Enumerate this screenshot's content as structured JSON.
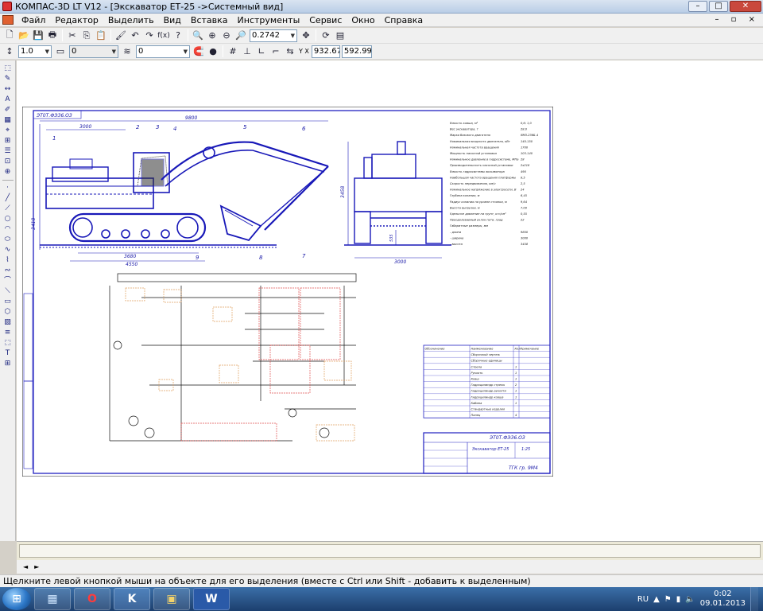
{
  "window": {
    "title": "КОМПАС-3D LT V12 - [Экскаватор ЕТ-25 ->Системный вид]",
    "minimize": "–",
    "maximize": "□",
    "close": "✕"
  },
  "menu": [
    "Файл",
    "Редактор",
    "Выделить",
    "Вид",
    "Вставка",
    "Инструменты",
    "Сервис",
    "Окно",
    "Справка"
  ],
  "mdi_controls": "– ▫ ×",
  "toolbar1": {
    "zoom_value": "0.2742",
    "icons": [
      "new-icon",
      "open-icon",
      "save-icon",
      "print-preview-icon",
      "cut-icon",
      "copy-icon",
      "paste-icon",
      "format-brush-icon",
      "undo-icon",
      "redo-icon",
      "function-icon",
      "help-pointer-icon",
      "zoom-window-icon",
      "zoom-in-icon",
      "zoom-out-icon",
      "zoom-scale-icon",
      "pan-icon",
      "refresh-icon",
      "layers-icon"
    ]
  },
  "toolbar2": {
    "scale_value": "1.0",
    "style_value": "0",
    "layer_value": "0",
    "coord_x": "932.679",
    "coord_y": "592.996",
    "coord_label": "Y X"
  },
  "status": {
    "text": "Щелкните левой кнопкой мыши на объекте для его выделения (вместе с Ctrl или Shift - добавить к выделенным)"
  },
  "taskbar": {
    "start_label": "⊞",
    "buttons": [
      {
        "name": "explorer",
        "label": "▦"
      },
      {
        "name": "opera",
        "label": "O"
      },
      {
        "name": "kompas",
        "label": "K"
      },
      {
        "name": "folder",
        "label": "▣"
      },
      {
        "name": "word",
        "label": "W"
      }
    ],
    "lang": "RU",
    "time": "0:02",
    "date": "09.01.2013"
  },
  "drawing": {
    "stamp_code": "ЭТ0Т.ФЭЗ6.ОЗ",
    "overall_length": "9800",
    "boom_length": "3000",
    "track_len_1": "3680",
    "track_len_2": "4550",
    "height_left": "3418",
    "side_width": "3000",
    "side_height": "3458",
    "clearance": "535",
    "callouts": [
      "1",
      "2",
      "3",
      "4",
      "5",
      "6",
      "7",
      "8",
      "9"
    ],
    "title_block_name": "Экскаватор ЕТ-25",
    "title_block_code": "ЭТ0Т.ФЭЗ6.ОЗ",
    "title_sheet": "ТГК гр. 9М4",
    "title_scale": "1:25",
    "spec_header": [
      "Обозначение",
      "Наименование",
      "Кол",
      "Примечание"
    ],
    "tech_rows": [
      {
        "label": "Емкость ковша, м³",
        "value": "0,6; 1,0"
      },
      {
        "label": "Вес экскаватора, т",
        "value": "28,0"
      },
      {
        "label": "Марка базового двигателя",
        "value": "ЯМЗ-236Б-4"
      },
      {
        "label": "Номинальная мощность двигателя, кВт",
        "value": "140-150"
      },
      {
        "label": "Номинальная частота вращения",
        "value": "1700"
      },
      {
        "label": "Мощность насосной установки",
        "value": "103-140"
      },
      {
        "label": "Номинальное давление в гидросистеме, МПа",
        "value": "28"
      },
      {
        "label": "Производительность насосной установки",
        "value": "2х218"
      },
      {
        "label": "Емкость гидросистемы экскаватора",
        "value": "490"
      },
      {
        "label": "Наибольшая частота вращения платформы",
        "value": "8,5"
      },
      {
        "label": "Скорость передвижения, км/ч",
        "value": "2,5"
      },
      {
        "label": "Номинальное напряжение в электросети, В",
        "value": "24"
      },
      {
        "label": "Глубина копания, м",
        "value": "6,45"
      },
      {
        "label": "Радиус копания на уровне стоянки, м",
        "value": "9,64"
      },
      {
        "label": "Высота выгрузки, м",
        "value": "7,00"
      },
      {
        "label": "Удельное давление на грунт, кгс/см²",
        "value": "0,55"
      },
      {
        "label": "Преодолеваемый уклон пути, град",
        "value": "22"
      },
      {
        "label": "Габаритные размеры, мм",
        "value": ""
      },
      {
        "label": "- длина",
        "value": "9800"
      },
      {
        "label": "- ширина",
        "value": "3000"
      },
      {
        "label": "- высота",
        "value": "3458"
      }
    ],
    "spec_rows": [
      {
        "name": "Сборочный чертеж",
        "qty": ""
      },
      {
        "name": "Сборочные единицы",
        "qty": ""
      },
      {
        "name": "Стрела",
        "qty": "1"
      },
      {
        "name": "Рукоять",
        "qty": "1"
      },
      {
        "name": "Ковш",
        "qty": "1"
      },
      {
        "name": "Гидроцилиндр стрелы",
        "qty": "2"
      },
      {
        "name": "Гидроцилиндр рукояти",
        "qty": "1"
      },
      {
        "name": "Гидроцилиндр ковша",
        "qty": "1"
      },
      {
        "name": "Кабина",
        "qty": "1"
      },
      {
        "name": "Стандартные изделия",
        "qty": ""
      },
      {
        "name": "Палец",
        "qty": "4"
      }
    ]
  }
}
